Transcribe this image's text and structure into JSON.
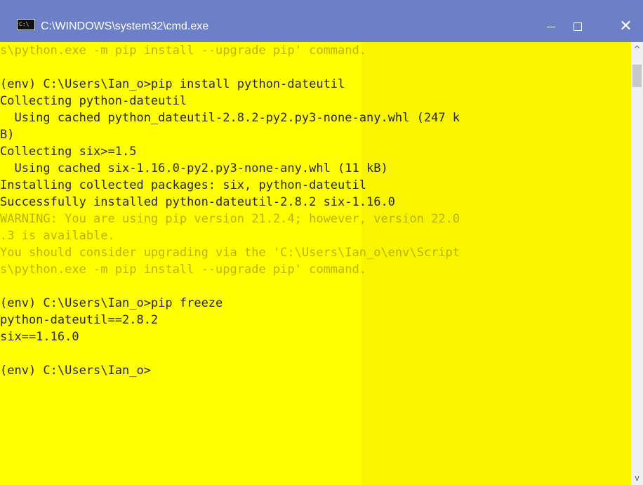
{
  "window": {
    "title": "C:\\WINDOWS\\system32\\cmd.exe",
    "app_icon_label": "C:\\",
    "buttons": {
      "minimize": "—",
      "maximize": "□",
      "close": "✕"
    }
  },
  "terminal": {
    "lines": [
      "s\\python.exe -m pip install --upgrade pip' command.",
      "",
      "(env) C:\\Users\\Ian_o>pip install python-dateutil",
      "Collecting python-dateutil",
      "  Using cached python_dateutil-2.8.2-py2.py3-none-any.whl (247 k",
      "B)",
      "Collecting six>=1.5",
      "  Using cached six-1.16.0-py2.py3-none-any.whl (11 kB)",
      "Installing collected packages: six, python-dateutil",
      "Successfully installed python-dateutil-2.8.2 six-1.16.0",
      "WARNING: You are using pip version 21.2.4; however, version 22.0",
      ".3 is available.",
      "You should consider upgrading via the 'C:\\Users\\Ian_o\\env\\Script",
      "s\\python.exe -m pip install --upgrade pip' command.",
      "",
      "(env) C:\\Users\\Ian_o>pip freeze",
      "python-dateutil==2.8.2",
      "six==1.16.0",
      "",
      "(env) C:\\Users\\Ian_o>"
    ]
  },
  "scrollbar": {
    "up_arrow": "^",
    "down_arrow": "v"
  },
  "colors": {
    "titlebar": "#6d7fc6",
    "terminal_background": "#ffff00",
    "text": "#2a2a2a",
    "warning_text": "#b8b300"
  }
}
